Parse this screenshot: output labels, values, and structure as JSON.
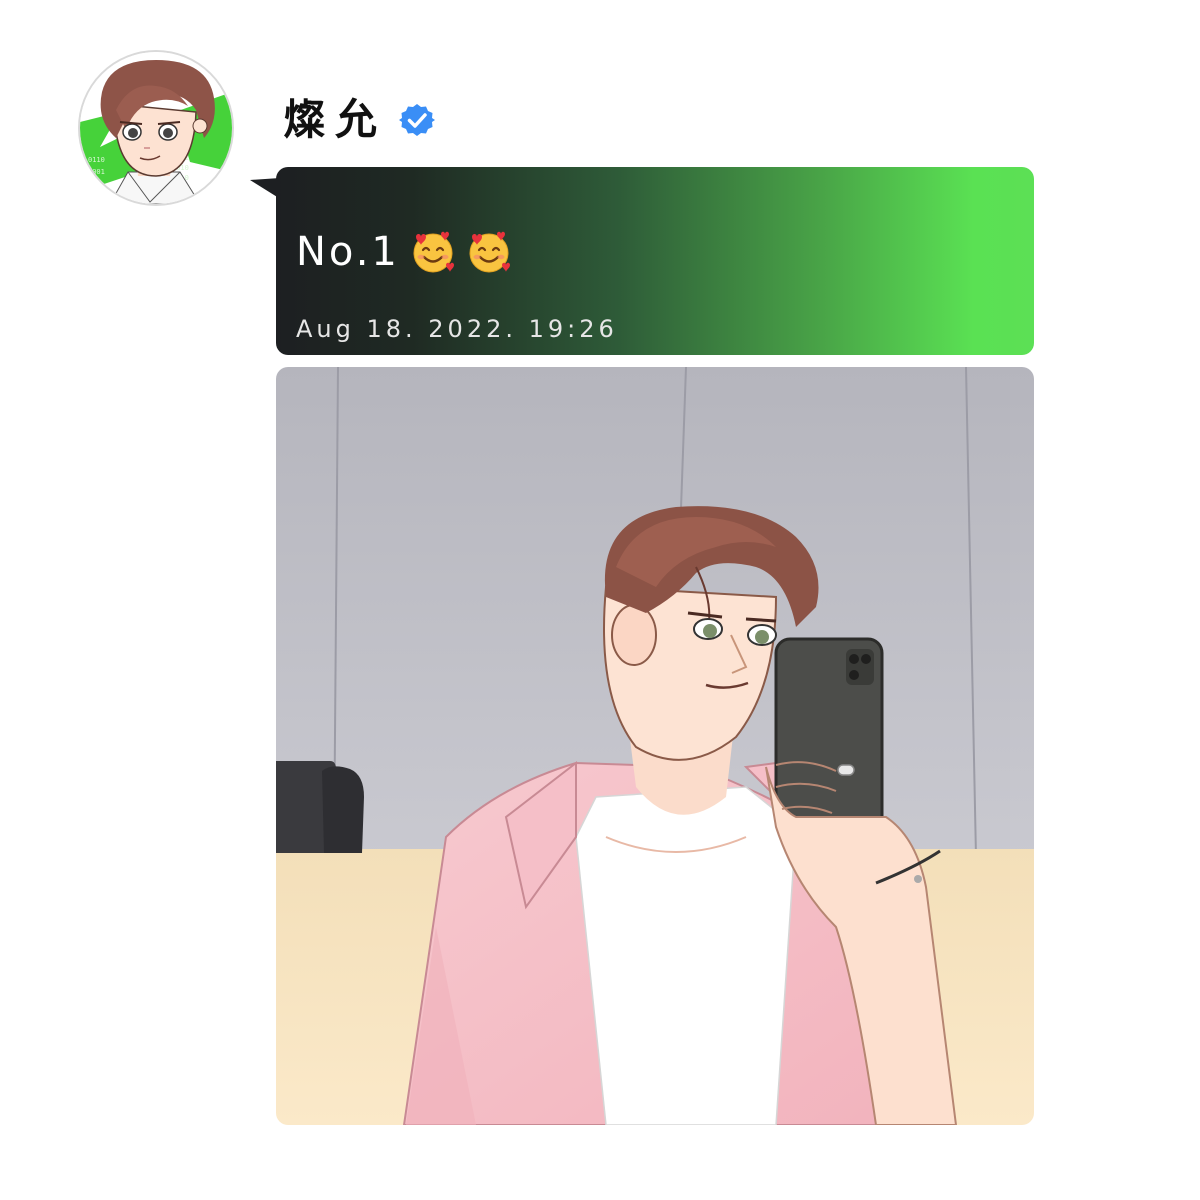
{
  "post": {
    "username": "燦允",
    "verified_icon": "verified-badge-icon",
    "verified_color": "#3a8ef6",
    "message": {
      "text": "No.1",
      "emojis": [
        "smiling-face-with-hearts-icon",
        "smiling-face-with-hearts-icon"
      ],
      "timestamp": "Aug 18. 2022. 19:26"
    },
    "bubble_gradient": [
      "#1d1f22",
      "#5ce055"
    ],
    "image": {
      "icon": "selfie-illustration"
    }
  },
  "avatar": {
    "icon": "profile-avatar-illustration",
    "accent": "#46d23a"
  }
}
